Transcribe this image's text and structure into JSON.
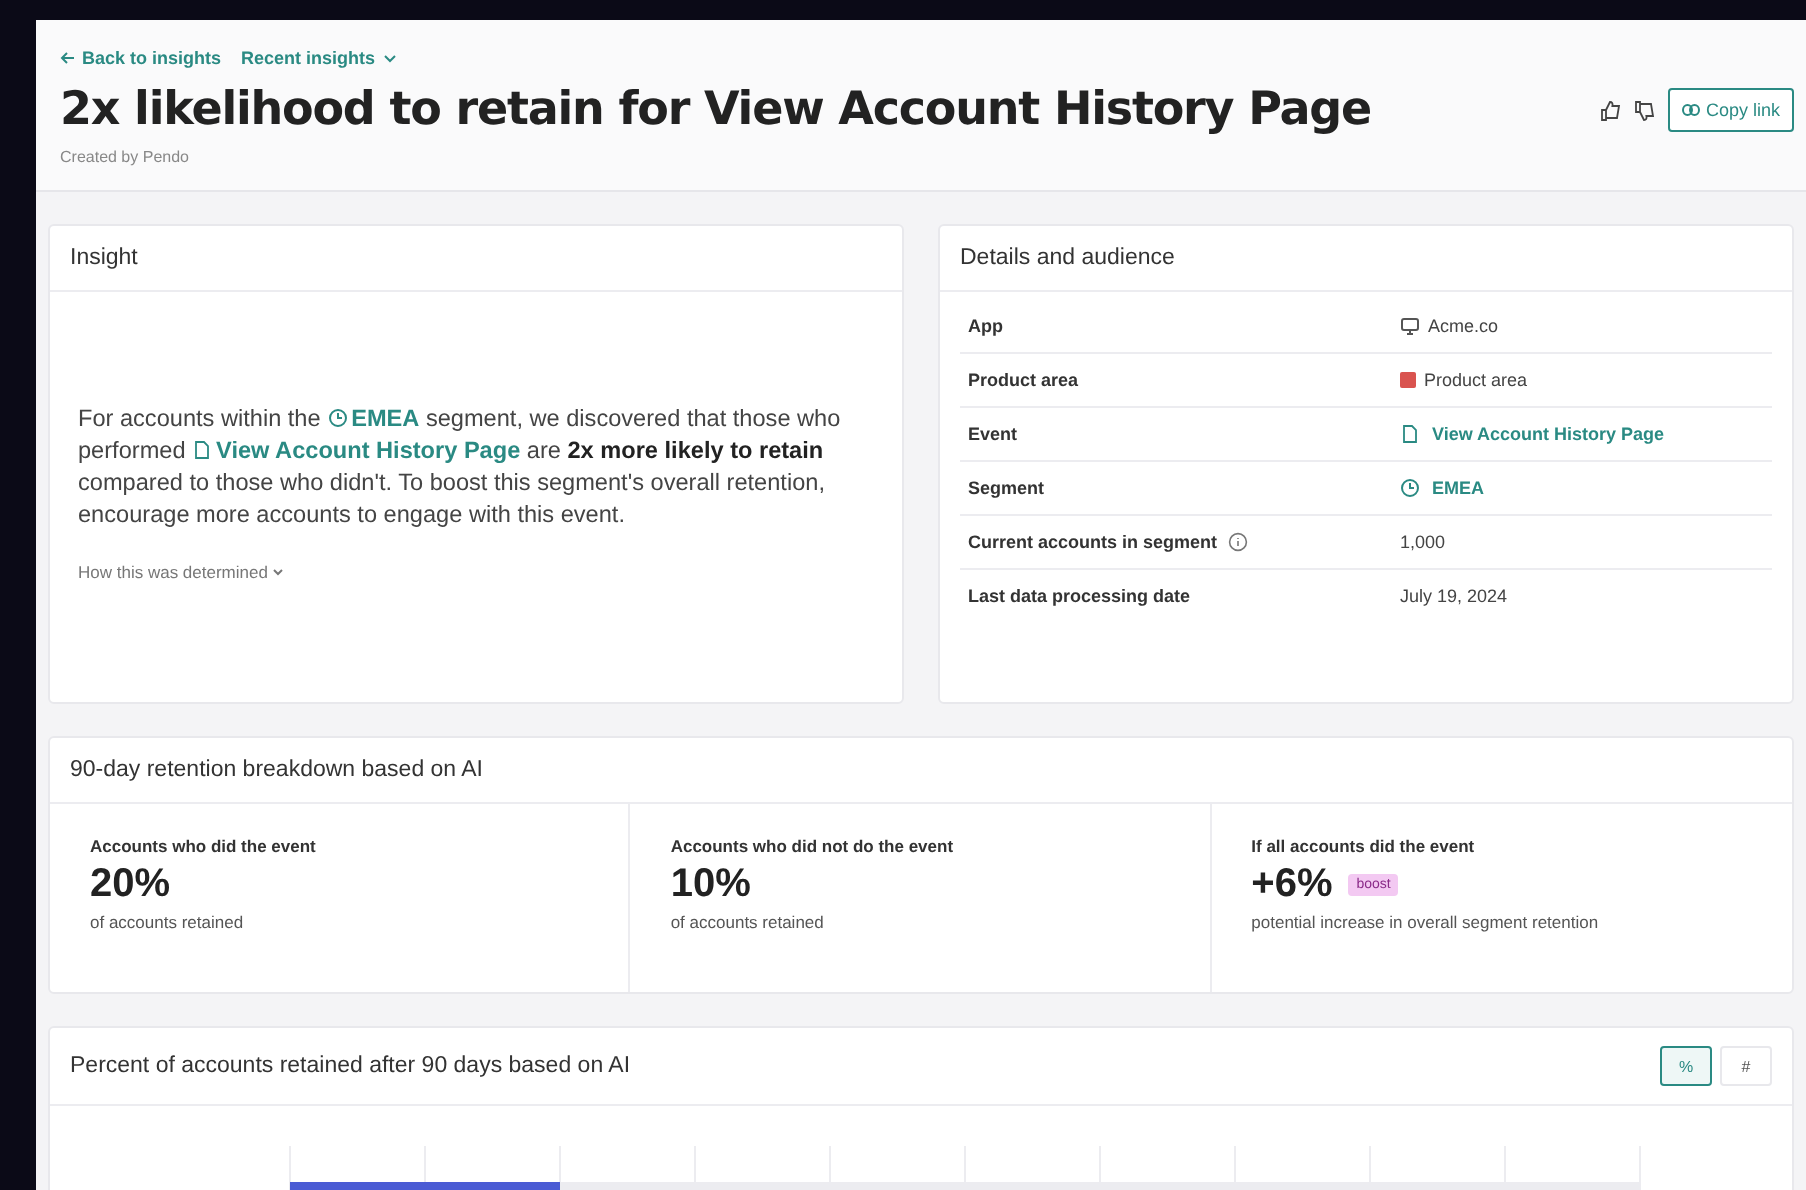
{
  "breadcrumbs": {
    "back": "Back to insights",
    "recent": "Recent insights"
  },
  "title": "2x likelihood to retain for View Account History Page",
  "created_by": "Created by Pendo",
  "actions": {
    "copy_link": "Copy link"
  },
  "insight": {
    "title": "Insight",
    "paragraph": [
      {
        "kind": "text",
        "text": "For accounts within the "
      },
      {
        "kind": "segment",
        "text": "EMEA"
      },
      {
        "kind": "text",
        "text": " segment, we discovered that those who performed "
      },
      {
        "kind": "event",
        "text": "View Account History Page"
      },
      {
        "kind": "text",
        "text": " are "
      },
      {
        "kind": "bold",
        "text": "2x more likely to retain"
      },
      {
        "kind": "text",
        "text": " compared to those who didn't. To boost this segment's overall retention, encourage more accounts to engage with this event."
      }
    ],
    "more": "How this was determined"
  },
  "details": {
    "title": "Details and audience",
    "rows": [
      {
        "label": "App",
        "kind": "app",
        "value": "Acme.co"
      },
      {
        "label": "Product area",
        "kind": "area",
        "value": "Product area",
        "color": "#d9534f"
      },
      {
        "label": "Event",
        "kind": "event",
        "value": "View Account History Page"
      },
      {
        "label": "Segment",
        "kind": "segment",
        "value": "EMEA"
      },
      {
        "label": "Current accounts in segment",
        "kind": "text",
        "value": "1,000",
        "info": true
      },
      {
        "label": "Last data processing date",
        "kind": "text",
        "value": "July 19, 2024"
      }
    ]
  },
  "breakdown": {
    "title": "90-day retention breakdown based on AI",
    "stats": [
      {
        "label": "Accounts who did the event",
        "value": "20%",
        "caption": "of accounts retained"
      },
      {
        "label": "Accounts who did not do the event",
        "value": "10%",
        "caption": "of accounts retained"
      },
      {
        "label": "If all accounts did the event",
        "value": "+6%",
        "badge": "boost",
        "caption": "potential increase in overall segment retention"
      }
    ]
  },
  "chart": {
    "title": "Percent of accounts retained after 90 days based on AI",
    "toggles": [
      {
        "label": "%",
        "selected": true
      },
      {
        "label": "#",
        "selected": false
      }
    ]
  }
}
